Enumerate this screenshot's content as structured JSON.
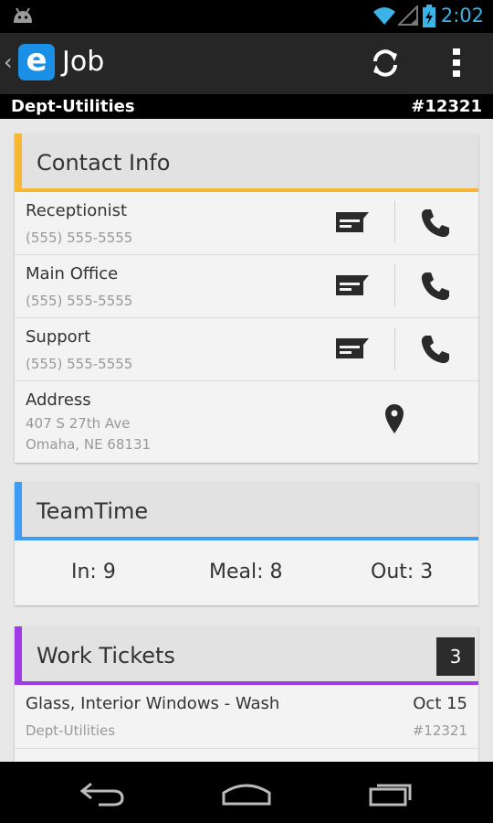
{
  "status_bar": {
    "time": "2:02"
  },
  "action_bar": {
    "title": "Job",
    "app_logo_letter": "e",
    "back_glyph": "‹"
  },
  "subheader": {
    "department": "Dept-Utilities",
    "job_number": "#12321"
  },
  "contact_info": {
    "title": "Contact Info",
    "accent": "#f8b730",
    "contacts": [
      {
        "name": "Receptionist",
        "phone": "(555) 555-5555"
      },
      {
        "name": "Main Office",
        "phone": "(555) 555-5555"
      },
      {
        "name": "Support",
        "phone": "(555) 555-5555"
      }
    ],
    "address": {
      "label": "Address",
      "line1": "407 S 27th Ave",
      "line2": "Omaha, NE 68131"
    }
  },
  "team_time": {
    "title": "TeamTime",
    "accent": "#3d9df5",
    "in": "In: 9",
    "meal": "Meal: 8",
    "out": "Out: 3"
  },
  "work_tickets": {
    "title": "Work Tickets",
    "accent": "#a13be8",
    "count": "3",
    "items": [
      {
        "title": "Glass, Interior Windows - Wash",
        "date": "Oct 15",
        "department": "Dept-Utilities",
        "number": "#12321"
      }
    ]
  },
  "icons": {
    "status": [
      "android-icon",
      "wifi-icon",
      "signal-icon",
      "battery-charging-icon"
    ],
    "action": [
      "refresh-icon",
      "overflow-menu-icon"
    ],
    "contact": [
      "message-icon",
      "phone-icon",
      "map-pin-icon"
    ],
    "nav": [
      "nav-back-icon",
      "nav-home-icon",
      "nav-recents-icon"
    ]
  }
}
